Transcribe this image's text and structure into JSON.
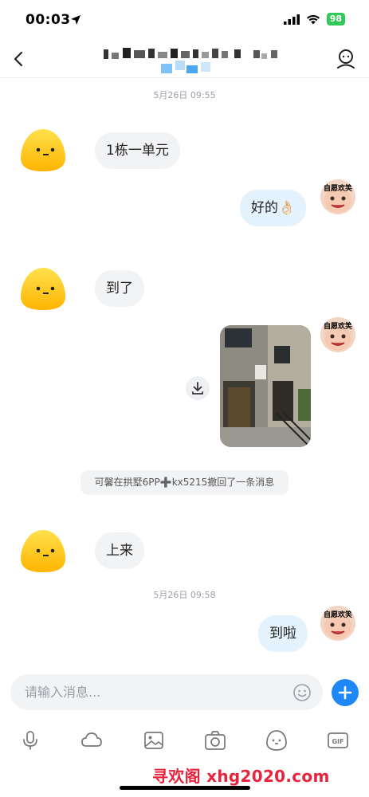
{
  "status_bar": {
    "time": "00:03",
    "battery": "98"
  },
  "messages": [
    {
      "type": "timestamp",
      "text": "5月26日 09:55"
    },
    {
      "type": "incoming",
      "text": "1栋一单元"
    },
    {
      "type": "outgoing",
      "text": "好的👌🏻"
    },
    {
      "type": "incoming",
      "text": "到了"
    },
    {
      "type": "outgoing-image"
    },
    {
      "type": "recall",
      "text": "可馨在拱墅6PP➕kx5215撤回了一条消息"
    },
    {
      "type": "incoming",
      "text": "上来"
    },
    {
      "type": "timestamp",
      "text": "5月26日 09:58"
    },
    {
      "type": "outgoing",
      "text": "到啦"
    }
  ],
  "sticker_text": "自愿欢笑",
  "input": {
    "placeholder": "请输入消息..."
  },
  "toolbar": [
    "mic-icon",
    "cloud-icon",
    "image-icon",
    "camera-icon",
    "sticker-icon",
    "gif-icon"
  ],
  "watermark": "寻欢阁 xhg2020.com",
  "colors": {
    "accent": "#1e88f6",
    "outgoing_bubble": "#e3f2fd",
    "incoming_bubble": "#f2f3f5",
    "watermark": "#e8233c"
  }
}
